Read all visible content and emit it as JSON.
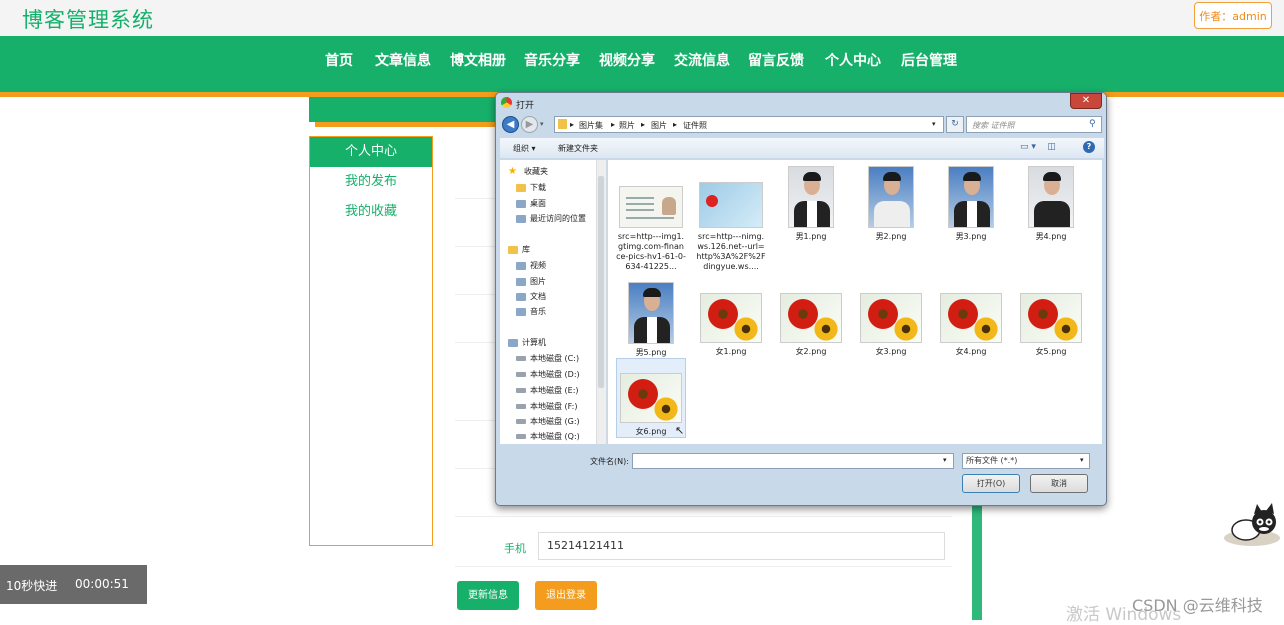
{
  "header": {
    "site_title": "博客管理系统",
    "author_label": "作者：admin"
  },
  "nav": [
    "首页",
    "文章信息",
    "博文相册",
    "音乐分享",
    "视频分享",
    "交流信息",
    "留言反馈",
    "个人中心",
    "后台管理"
  ],
  "sidebar": {
    "items": [
      "个人中心",
      "我的发布",
      "我的收藏"
    ]
  },
  "form": {
    "phone_label": "手机",
    "phone_value": "15214121411",
    "update_button": "更新信息",
    "logout_button": "退出登录"
  },
  "video_overlay": {
    "speed_label": "10秒快进",
    "time": "00:00:51"
  },
  "watermarks": {
    "activate": "激活 Windows",
    "csdn": "CSDN @云维科技"
  },
  "dialog": {
    "title": "打开",
    "path": [
      "图片集",
      "照片",
      "图片",
      "证件照"
    ],
    "search_placeholder": "搜索 证件照",
    "toolbar": {
      "organize": "组织 ▾",
      "new_folder": "新建文件夹"
    },
    "nav_pane": {
      "favorites_header": "收藏夹",
      "favorites": [
        "下载",
        "桌面",
        "最近访问的位置"
      ],
      "library_header": "库",
      "library": [
        "视频",
        "图片",
        "文档",
        "音乐"
      ],
      "computer_header": "计算机",
      "drives": [
        "本地磁盘 (C:)",
        "本地磁盘 (D:)",
        "本地磁盘 (E:)",
        "本地磁盘 (F:)",
        "本地磁盘 (G:)",
        "本地磁盘 (Q:)"
      ]
    },
    "files": [
      {
        "name": "src=http---img1.gtimg.com-finance-pics-hv1-61-0-634-41225...",
        "kind": "idcard"
      },
      {
        "name": "src=http---nimg.ws.126.net--url=http%3A%2F%2Fdingyue.ws....",
        "kind": "idcard2"
      },
      {
        "name": "男1.png",
        "kind": "portrait"
      },
      {
        "name": "男2.png",
        "kind": "portrait"
      },
      {
        "name": "男3.png",
        "kind": "portrait"
      },
      {
        "name": "男4.png",
        "kind": "portrait-w"
      },
      {
        "name": "男5.png",
        "kind": "portrait"
      },
      {
        "name": "女1.png",
        "kind": "flower"
      },
      {
        "name": "女2.png",
        "kind": "flower"
      },
      {
        "name": "女3.png",
        "kind": "flower"
      },
      {
        "name": "女4.png",
        "kind": "flower"
      },
      {
        "name": "女5.png",
        "kind": "flower"
      },
      {
        "name": "女6.png",
        "kind": "flower"
      }
    ],
    "filename_label": "文件名(N):",
    "filename_value": "",
    "filetype": "所有文件 (*.*)",
    "open_button": "打开(O)",
    "cancel_button": "取消"
  }
}
